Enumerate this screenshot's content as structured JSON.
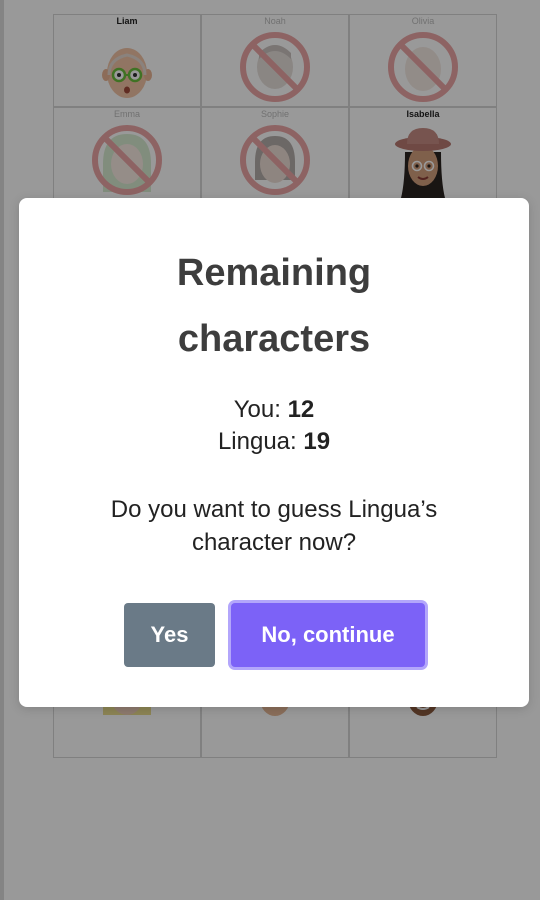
{
  "grid": {
    "characters": [
      {
        "name": "Liam",
        "eliminated": false,
        "face": "liam"
      },
      {
        "name": "Noah",
        "eliminated": true,
        "face": "generic"
      },
      {
        "name": "Olivia",
        "eliminated": true,
        "face": "generic"
      },
      {
        "name": "Emma",
        "eliminated": true,
        "face": "generic"
      },
      {
        "name": "Sophie",
        "eliminated": true,
        "face": "generic"
      },
      {
        "name": "Isabella",
        "eliminated": false,
        "face": "isabella"
      }
    ]
  },
  "modal": {
    "title_line1": "Remaining",
    "title_line2": "characters",
    "you_label": "You:",
    "you_count": "12",
    "opponent_label": "Lingua:",
    "opponent_count": "19",
    "question_line1": "Do you want to guess Lingua’s",
    "question_line2": "character now?",
    "yes_label": "Yes",
    "no_label": "No, continue"
  },
  "colors": {
    "yes_button": "#6a7a87",
    "no_button": "#7c62f7",
    "eliminated_mark": "#d63a3a"
  },
  "icons": {
    "eliminated": "no-sign-icon"
  }
}
